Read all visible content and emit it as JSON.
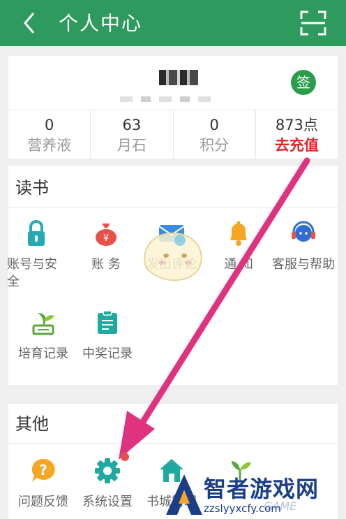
{
  "header": {
    "title": "个人中心"
  },
  "profile": {
    "sign_badge": "签",
    "stats": [
      {
        "value": "0",
        "label": "营养液",
        "highlight": false
      },
      {
        "value": "63",
        "label": "月石",
        "highlight": false
      },
      {
        "value": "0",
        "label": "积分",
        "highlight": false
      },
      {
        "value": "873点",
        "label": "去充值",
        "highlight": true
      }
    ]
  },
  "read_section": {
    "title": "读书",
    "items": [
      {
        "label": "账号与安全",
        "icon": "lock-icon"
      },
      {
        "label": "账 务",
        "icon": "money-bag-icon"
      },
      {
        "label": "发出评论",
        "icon": "envelope-icon"
      },
      {
        "label": "通 知",
        "icon": "bell-icon"
      },
      {
        "label": "客服与帮助",
        "icon": "headset-icon"
      },
      {
        "label": "培育记录",
        "icon": "plant-icon"
      },
      {
        "label": "中奖记录",
        "icon": "clipboard-icon"
      }
    ]
  },
  "other_section": {
    "title": "其他",
    "items": [
      {
        "label": "问题反馈",
        "icon": "question-bubble-icon"
      },
      {
        "label": "系统设置",
        "icon": "gear-icon"
      },
      {
        "label": "书城管理",
        "icon": "house-icon"
      },
      {
        "label": "",
        "icon": "sprout-icon"
      }
    ]
  },
  "watermark": {
    "main": "智者游戏网",
    "sub": "zzslyyxcfy.com",
    "ghost": "GAME"
  },
  "colors": {
    "header": "#2f9a5e",
    "accent_red": "#d9262b",
    "arrow": "#e0337f",
    "watermark": "#1b3f86"
  }
}
